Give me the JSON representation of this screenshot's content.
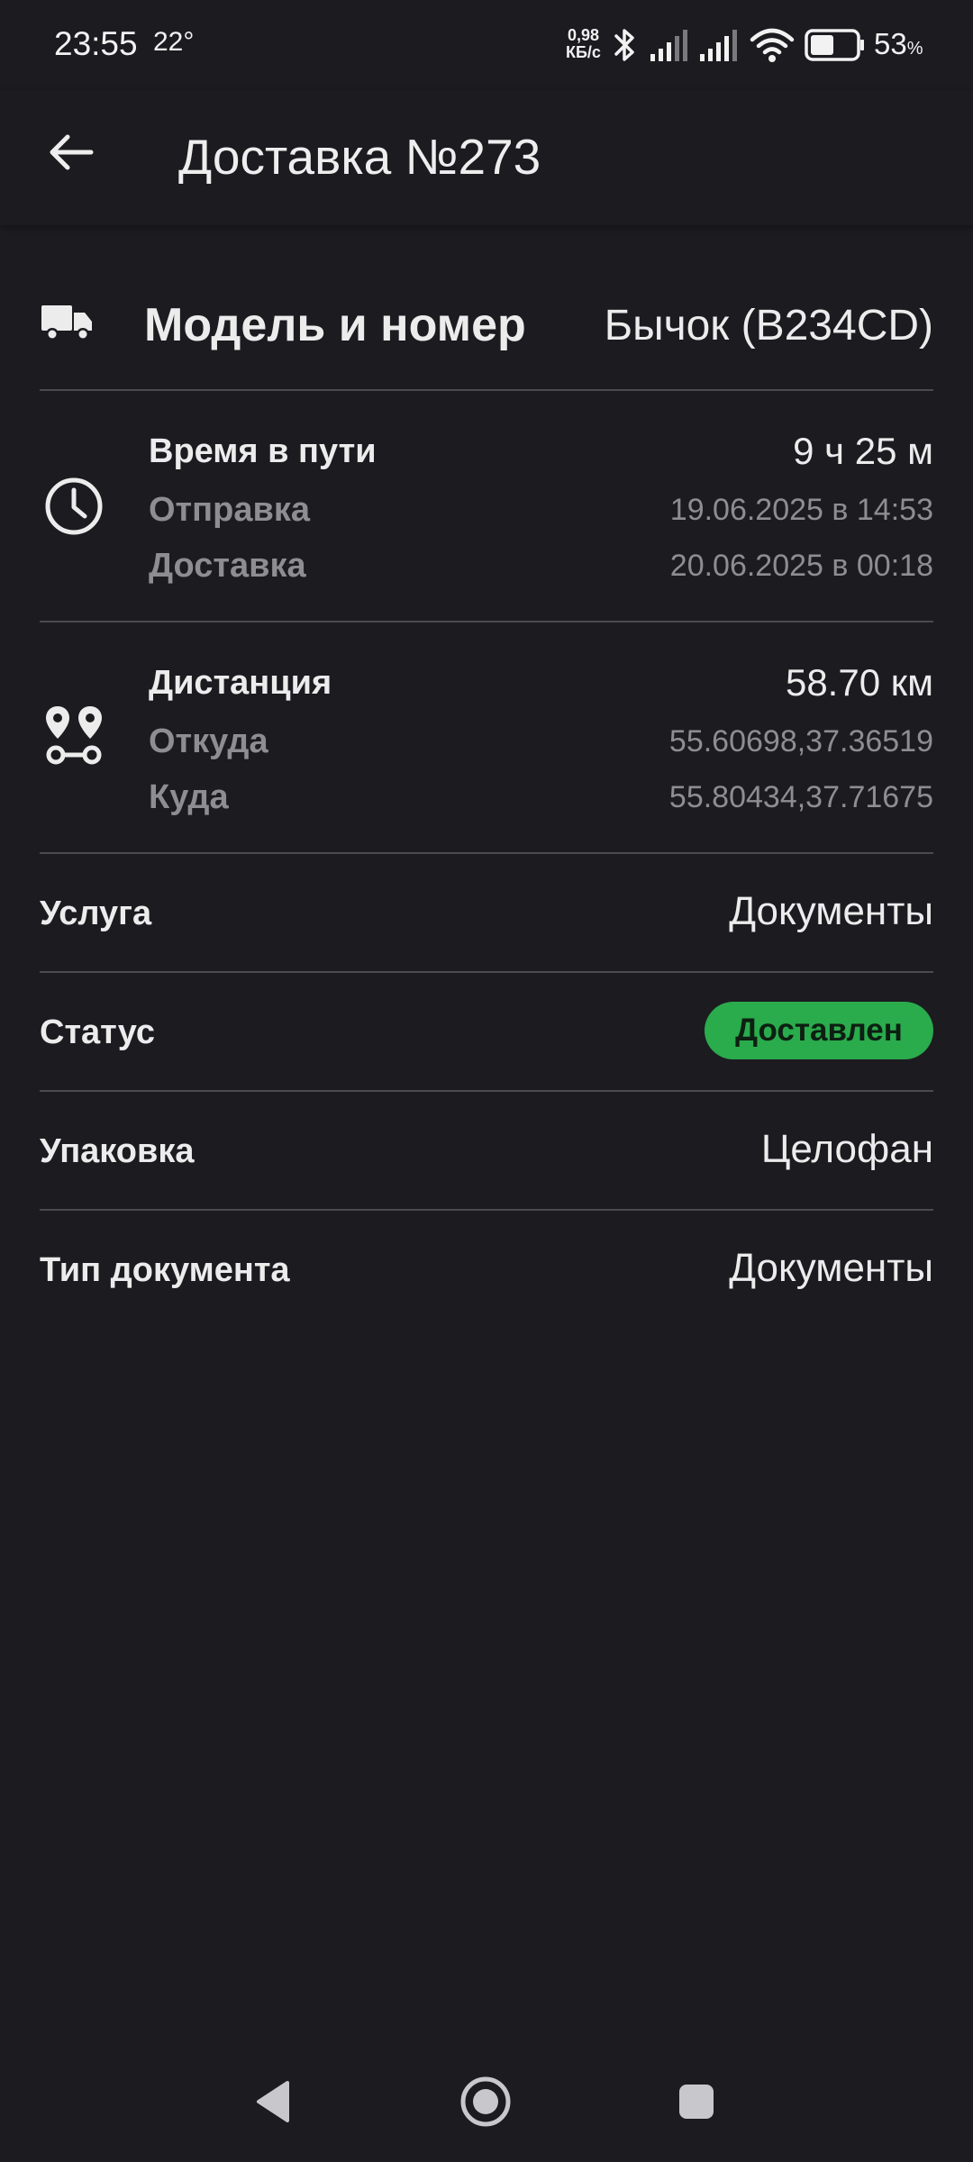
{
  "status_bar": {
    "time": "23:55",
    "temperature": "22°",
    "net_speed_value": "0,98",
    "net_speed_unit": "КБ/с",
    "battery_percent": "53",
    "battery_unit": "%",
    "battery_level": 0.53,
    "icons": [
      "bluetooth-icon",
      "signal-icon",
      "signal-icon",
      "wifi-icon",
      "battery-icon"
    ]
  },
  "app_bar": {
    "title": "Доставка №273",
    "back_icon": "arrow-left-icon"
  },
  "vehicle": {
    "icon": "truck-icon",
    "label": "Модель и номер",
    "value": "Бычок (В234CD)"
  },
  "time_block": {
    "icon": "clock-icon",
    "label": "Время в пути",
    "value": "9 ч 25 м",
    "departure_label": "Отправка",
    "departure_value": "19.06.2025 в 14:53",
    "delivery_label": "Доставка",
    "delivery_value": "20.06.2025 в 00:18"
  },
  "distance_block": {
    "icon": "route-icon",
    "label": "Дистанция",
    "value": "58.70 км",
    "from_label": "Откуда",
    "from_value": "55.60698,37.36519",
    "to_label": "Куда",
    "to_value": "55.80434,37.71675"
  },
  "details": {
    "service_label": "Услуга",
    "service_value": "Документы",
    "status_label": "Статус",
    "status_value": "Доставлен",
    "status_color": "#2aab4c",
    "packaging_label": "Упаковка",
    "packaging_value": "Целофан",
    "doctype_label": "Тип документа",
    "doctype_value": "Документы"
  },
  "nav_bar": {
    "icons": [
      "back-triangle-icon",
      "home-circle-icon",
      "recents-square-icon"
    ]
  }
}
